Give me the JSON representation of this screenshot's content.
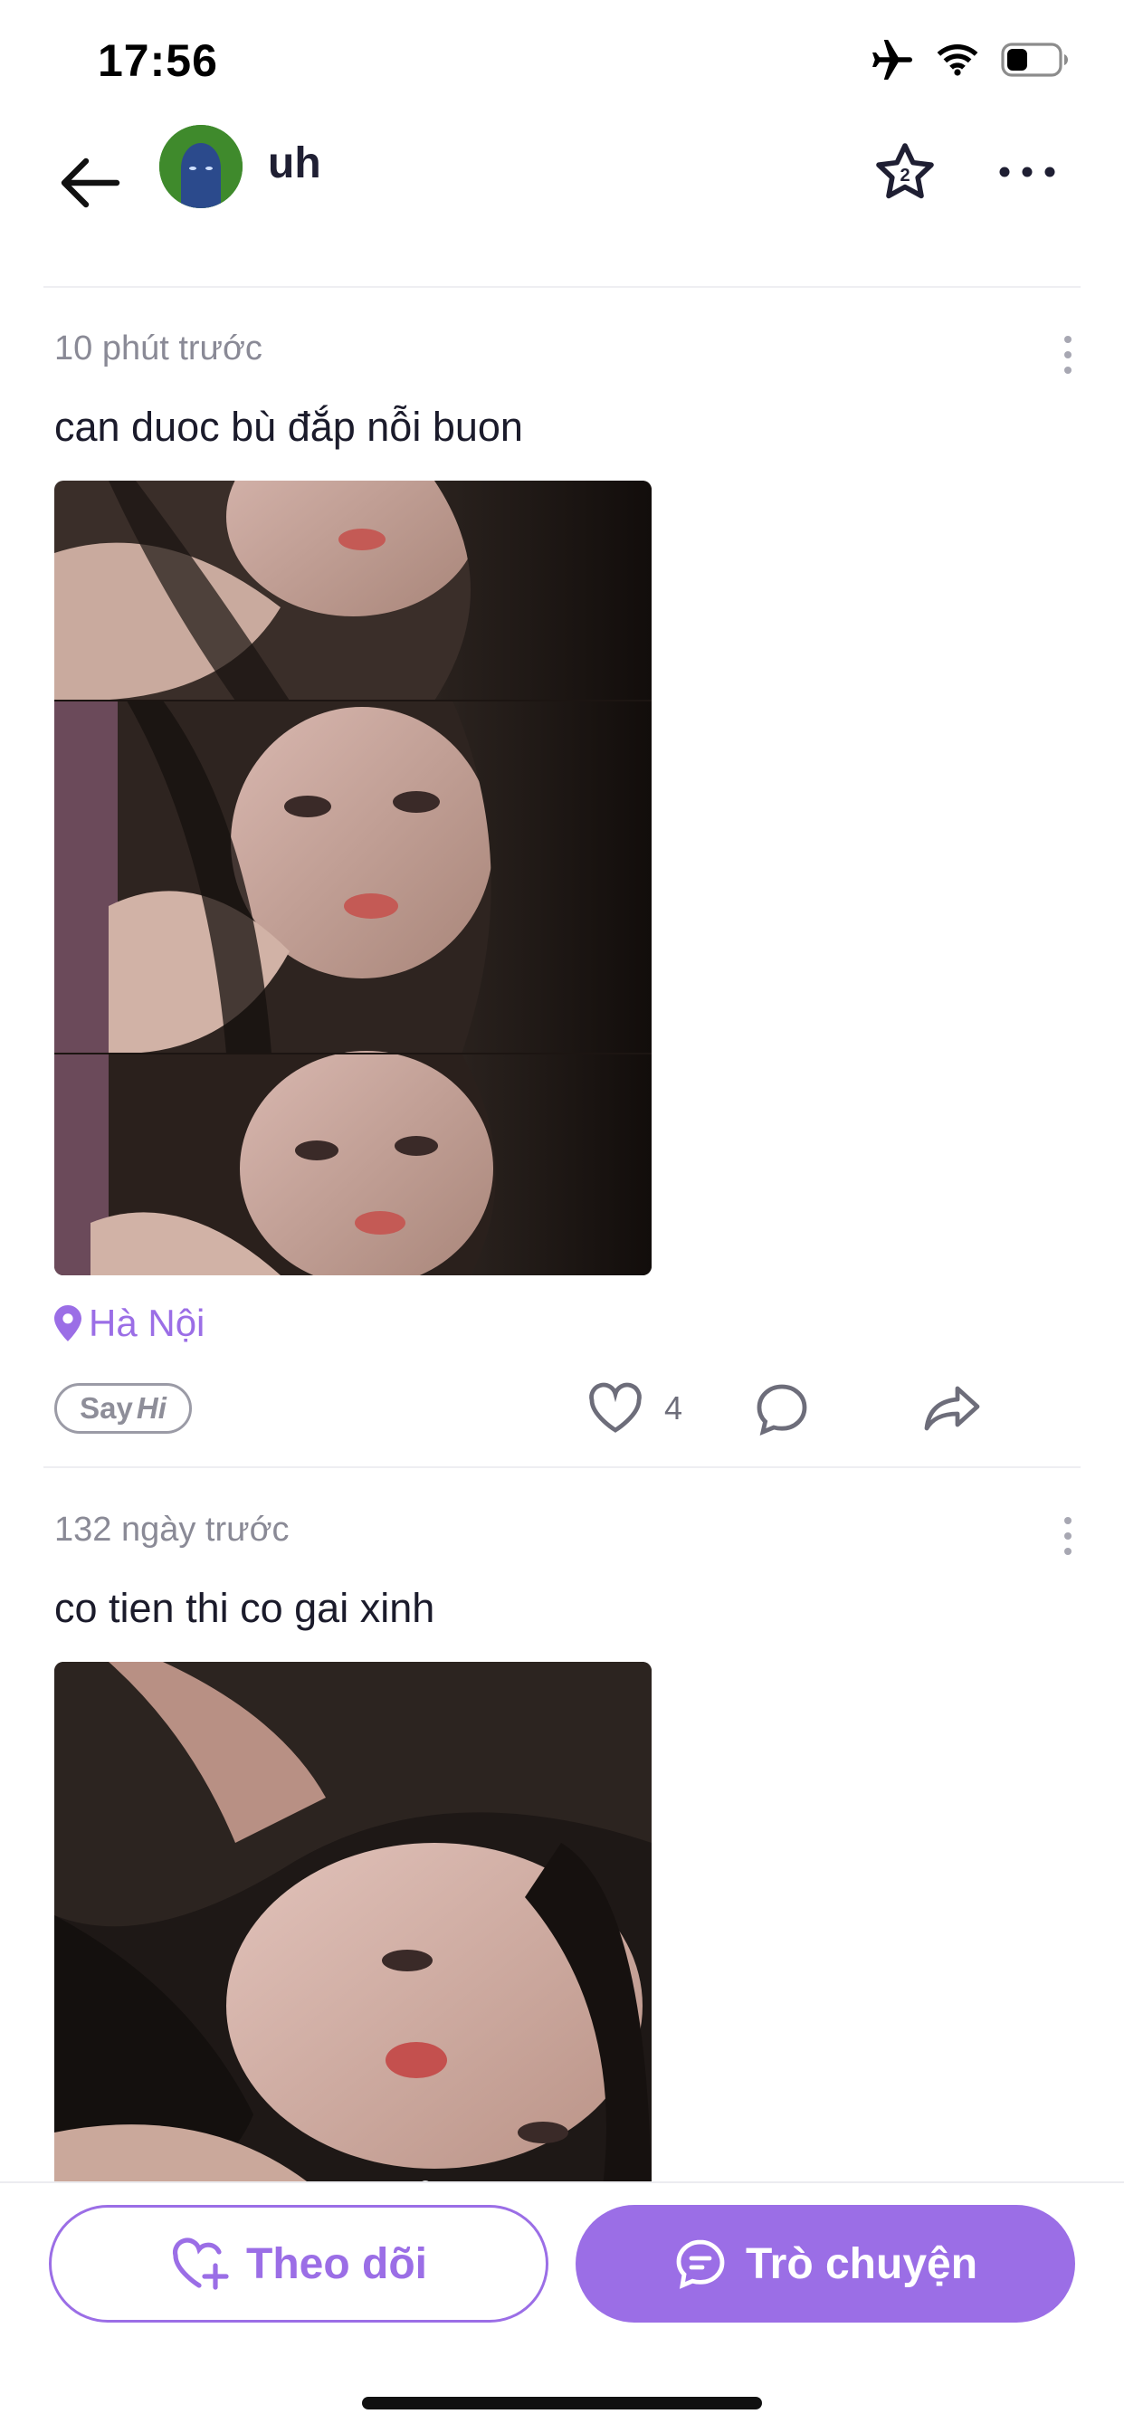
{
  "status_bar": {
    "time": "17:56"
  },
  "header": {
    "username": "uh"
  },
  "posts": [
    {
      "time": "10 phút trước",
      "text": "can duoc bù đắp nỗi buon",
      "location": "Hà Nội",
      "likes": "4",
      "say_hi": "Say",
      "say_hi_em": "Hi"
    },
    {
      "time": "132 ngày trước",
      "text": "co tien thi co gai xinh"
    }
  ],
  "bottom_bar": {
    "follow_label": "Theo dõi",
    "chat_label": "Trò chuyện"
  },
  "colors": {
    "accent": "#9b6ee6",
    "text": "#1b1b2b",
    "muted": "#8a8a96"
  }
}
